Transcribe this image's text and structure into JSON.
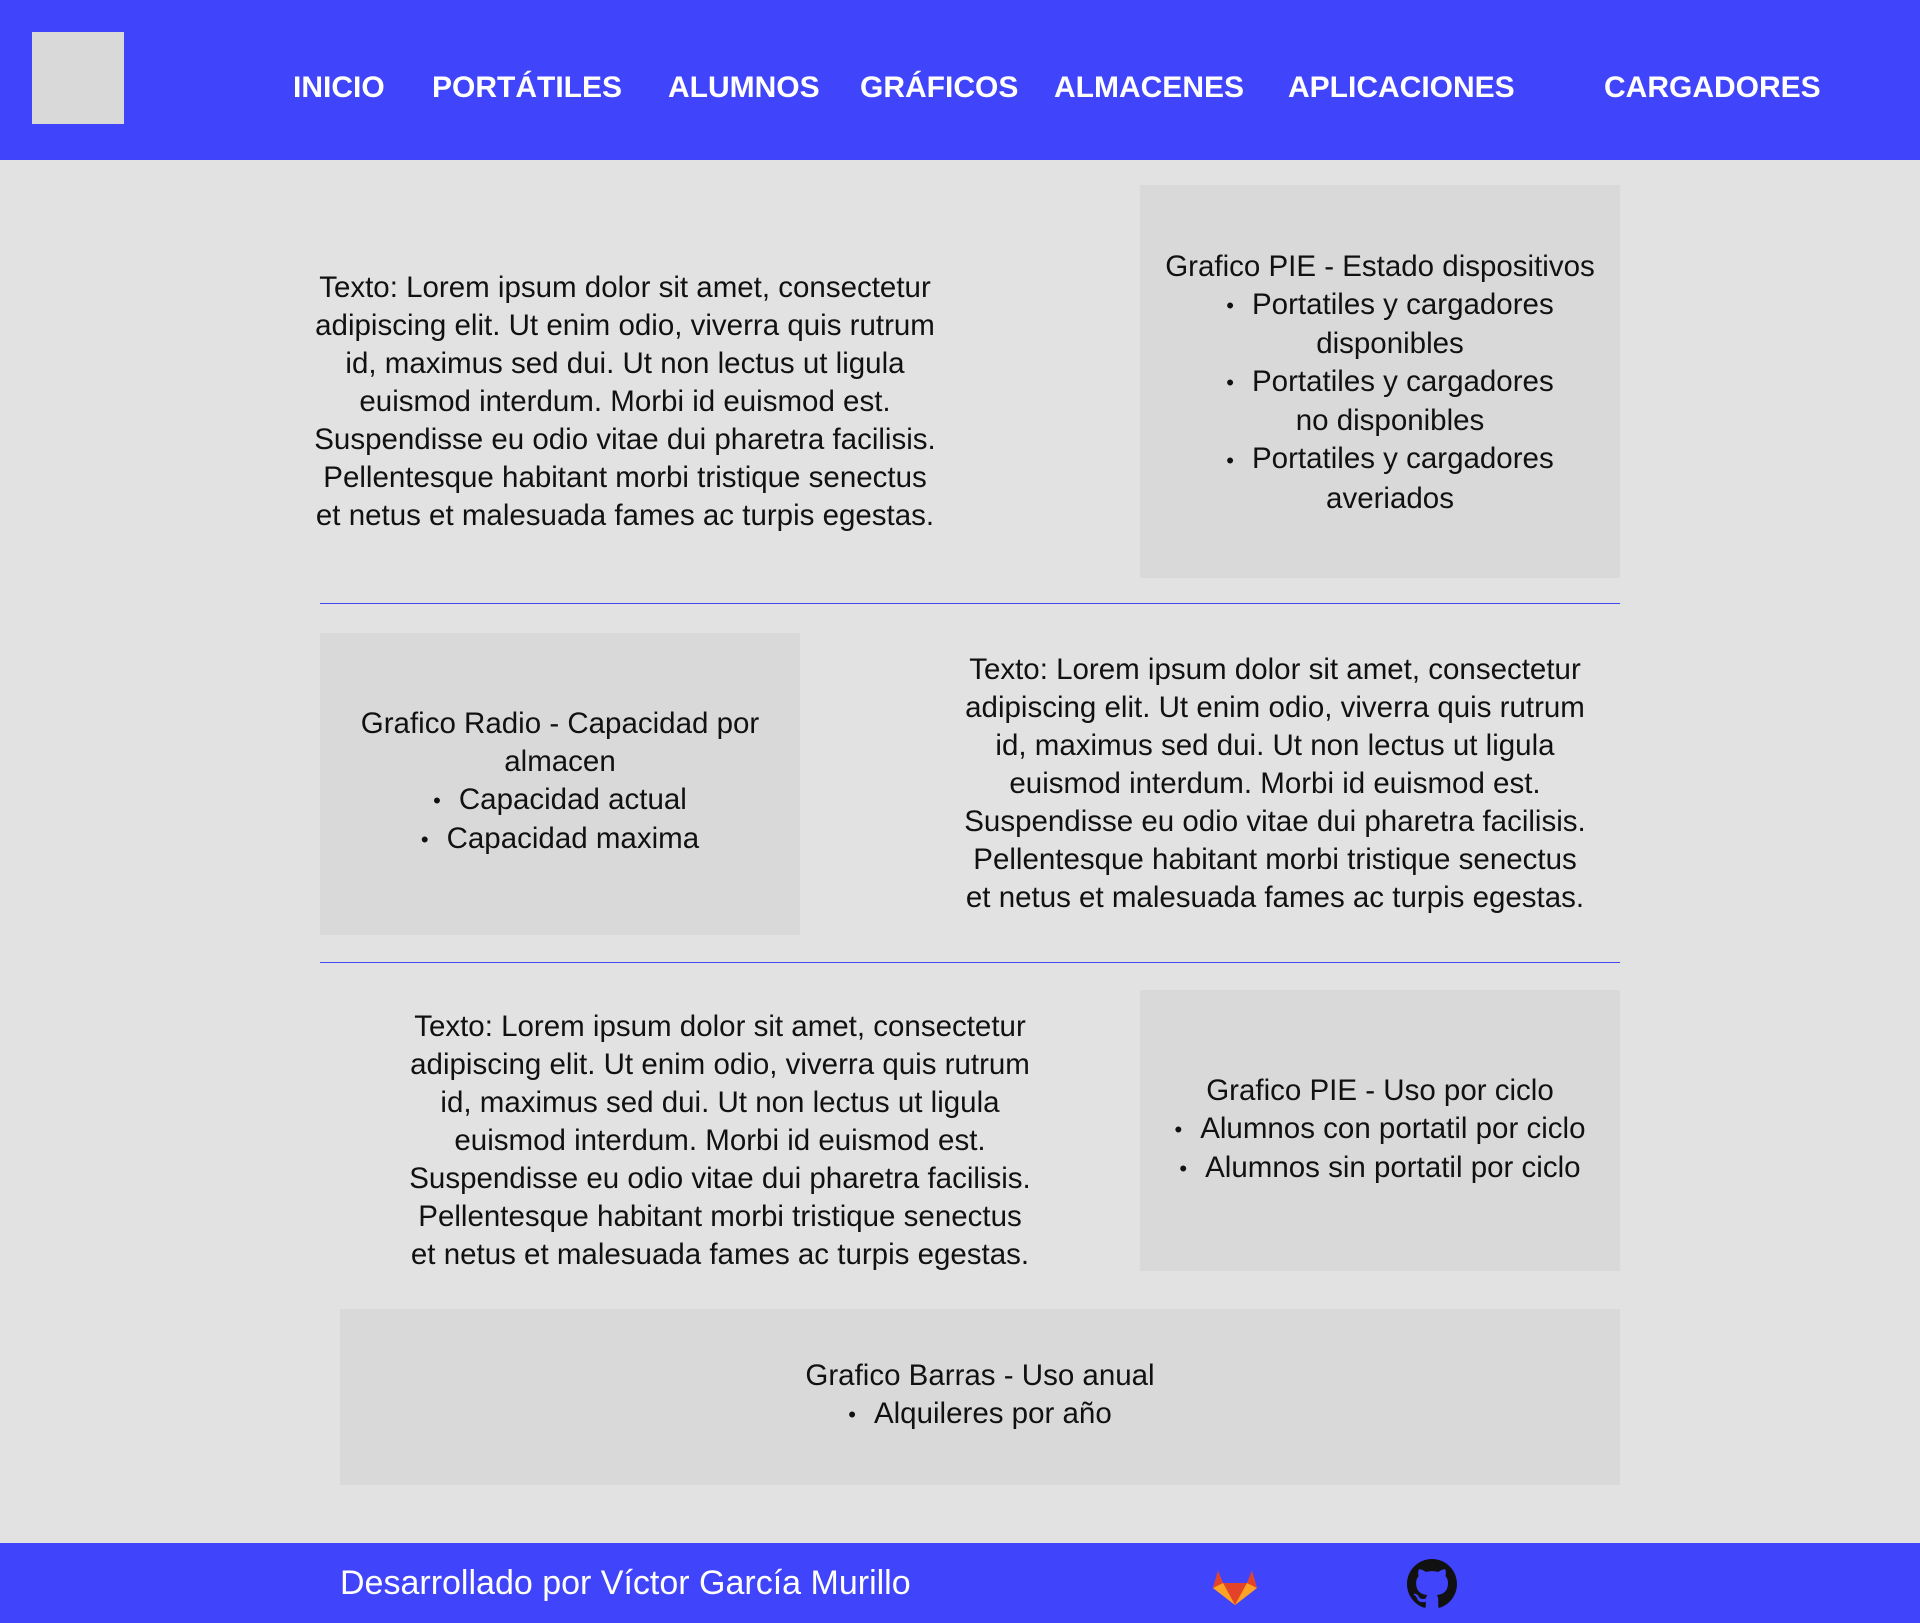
{
  "nav": {
    "items": [
      "INICIO",
      "PORTÁTILES",
      "ALUMNOS",
      "GRÁFICOS",
      "ALMACENES",
      "APLICACIONES",
      "CARGADORES"
    ]
  },
  "lorem_lines": [
    "Texto: Lorem ipsum dolor sit amet, consectetur",
    "adipiscing elit. Ut enim odio,  viverra quis rutrum",
    "id, maximus sed dui. Ut non lectus ut ligula",
    "euismod  interdum. Morbi id euismod est.",
    "Suspendisse eu odio vitae dui pharetra  facilisis.",
    "Pellentesque habitant morbi tristique senectus",
    "et netus et  malesuada fames ac turpis egestas."
  ],
  "charts": {
    "pie_estado": {
      "title": "Grafico PIE - Estado dispositivos",
      "bullets": [
        "Portatiles y cargadores disponibles",
        "Portatiles y cargadores no disponibles",
        "Portatiles y cargadores averiados"
      ]
    },
    "radio_capacidad": {
      "title": "Grafico Radio - Capacidad por almacen",
      "bullets": [
        "Capacidad actual",
        "Capacidad maxima"
      ]
    },
    "pie_uso": {
      "title": "Grafico PIE - Uso por ciclo",
      "bullets": [
        "Alumnos con portatil por ciclo",
        "Alumnos sin portatil por ciclo"
      ]
    },
    "barras_uso": {
      "title": "Grafico Barras - Uso anual",
      "bullets": [
        "Alquileres por año"
      ]
    }
  },
  "footer": {
    "credit": "Desarrollado por Víctor García Murillo",
    "icons": [
      "gitlab-icon",
      "github-icon"
    ]
  },
  "colors": {
    "header_bg": "#4044fb",
    "placeholder_gray": "#d9d9d9",
    "page_bg": "#e2e2e2"
  }
}
